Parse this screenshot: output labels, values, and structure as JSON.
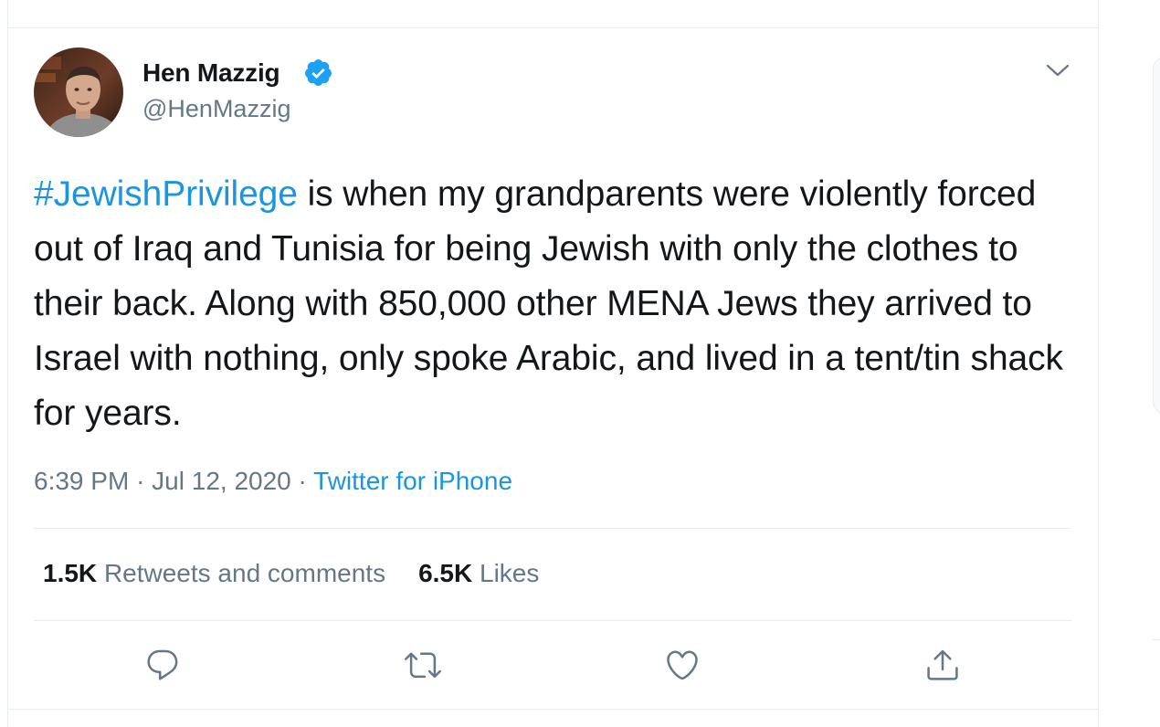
{
  "colors": {
    "accent": "#1b95e0",
    "text": "#14171a",
    "secondary": "#657786",
    "border": "#e6ecf0"
  },
  "tweet": {
    "author": {
      "name": "Hen Mazzig",
      "handle": "@HenMazzig",
      "verified_icon": "verified-badge-icon"
    },
    "text": {
      "hashtag": "#JewishPrivilege",
      "body": " is when my grandparents were violently forced out of Iraq and Tunisia for being Jewish with only the clothes to their back. Along with 850,000 other MENA Jews they arrived to Israel with nothing, only spoke Arabic, and lived in a tent/tin shack for years."
    },
    "meta": {
      "time": "6:39 PM",
      "separator": "·",
      "date": "Jul 12, 2020",
      "source": "Twitter for iPhone"
    },
    "stats": {
      "retweets_count": "1.5K",
      "retweets_label": "Retweets and comments",
      "likes_count": "6.5K",
      "likes_label": "Likes"
    },
    "actions": [
      "reply-icon",
      "retweet-icon",
      "like-icon",
      "share-icon"
    ]
  }
}
